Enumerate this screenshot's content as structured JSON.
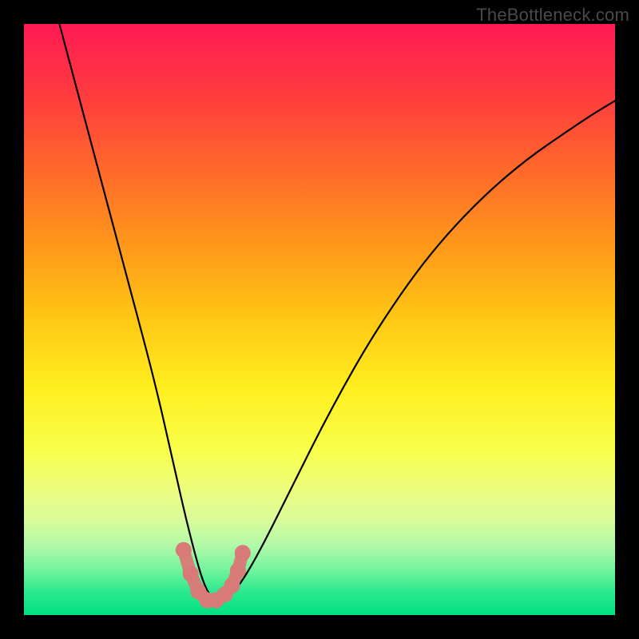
{
  "watermark": "TheBottleneck.com",
  "chart_data": {
    "type": "line",
    "title": "",
    "xlabel": "",
    "ylabel": "",
    "xlim": [
      0,
      100
    ],
    "ylim": [
      0,
      100
    ],
    "grid": false,
    "legend": false,
    "notes": "Axes and ticks are not visible; values are estimated in percent of plot width/height (0,0 at bottom-left). Background heatmap encodes value by vertical position (red high → green low).",
    "series": [
      {
        "name": "bottleneck-curve",
        "color": "#000000",
        "x": [
          6,
          10,
          14,
          18,
          22,
          25,
          27,
          29,
          30.5,
          32,
          34,
          36.5,
          40,
          45,
          52,
          60,
          70,
          82,
          95,
          100
        ],
        "y": [
          100,
          85,
          70,
          55,
          40,
          27,
          18,
          10,
          5,
          2.5,
          2.5,
          5,
          11,
          21,
          35,
          49,
          63,
          75,
          84,
          87
        ]
      },
      {
        "name": "marker-band",
        "color": "#d87a78",
        "type": "scatter",
        "x": [
          27.0,
          28.2,
          29.5,
          31.0,
          32.5,
          34.0,
          35.2,
          36.2,
          37.0
        ],
        "y": [
          11.0,
          7.0,
          4.0,
          2.5,
          2.5,
          3.5,
          5.0,
          7.5,
          10.5
        ]
      }
    ]
  }
}
